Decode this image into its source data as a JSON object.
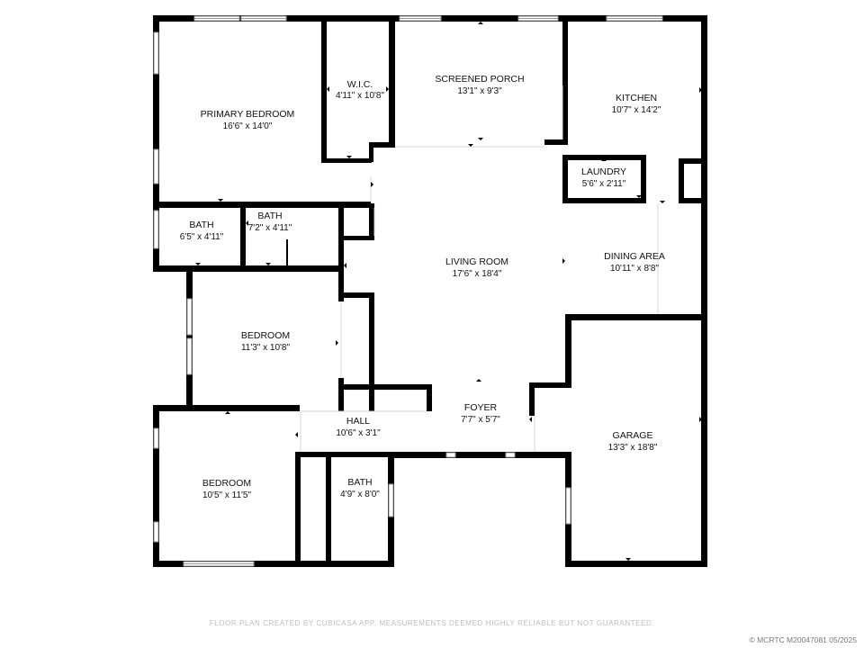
{
  "rooms": {
    "primary_bedroom": {
      "name": "PRIMARY BEDROOM",
      "dims": "16'6\" x 14'0\""
    },
    "wic": {
      "name": "W.I.C.",
      "dims": "4'11\" x 10'8\""
    },
    "screened_porch": {
      "name": "SCREENED PORCH",
      "dims": "13'1\" x 9'3\""
    },
    "kitchen": {
      "name": "KITCHEN",
      "dims": "10'7\" x 14'2\""
    },
    "laundry": {
      "name": "LAUNDRY",
      "dims": "5'6\" x 2'11\""
    },
    "bath_1": {
      "name": "BATH",
      "dims": "6'5\" x 4'11\""
    },
    "bath_2": {
      "name": "BATH",
      "dims": "7'2\" x 4'11\""
    },
    "living_room": {
      "name": "LIVING ROOM",
      "dims": "17'6\" x 18'4\""
    },
    "dining_area": {
      "name": "DINING AREA",
      "dims": "10'11\" x 8'8\""
    },
    "bedroom_1": {
      "name": "BEDROOM",
      "dims": "11'3\" x 10'8\""
    },
    "hall": {
      "name": "HALL",
      "dims": "10'6\" x 3'1\""
    },
    "foyer": {
      "name": "FOYER",
      "dims": "7'7\" x 5'7\""
    },
    "garage": {
      "name": "GARAGE",
      "dims": "13'3\" x 18'8\""
    },
    "bedroom_2": {
      "name": "BEDROOM",
      "dims": "10'5\" x 11'5\""
    },
    "bath_3": {
      "name": "BATH",
      "dims": "4'9\" x 8'0\""
    }
  },
  "footer": {
    "disclaimer": "FLOOR PLAN CREATED BY CUBICASA APP. MEASUREMENTS DEEMED HIGHLY RELIABLE BUT NOT GUARANTEED.",
    "copyright": "© MCRTC M20047081 05/2025"
  },
  "colors": {
    "wall": "#000000",
    "background": "#ffffff",
    "footer_text": "#bdbdbd"
  }
}
